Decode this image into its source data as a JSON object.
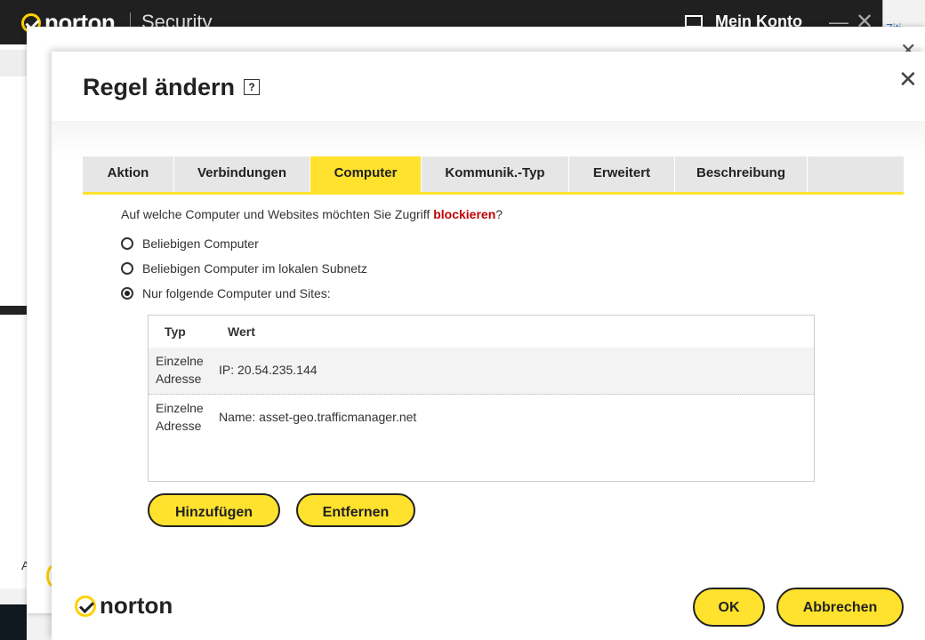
{
  "background_window": {
    "brand": "norton",
    "product": "Security",
    "account_label": "Mein Konto",
    "side_letter": "A",
    "right_edge_text": "Ziti"
  },
  "dialog": {
    "title": "Regel ändern",
    "help_glyph": "?",
    "close_glyph": "✕",
    "tabs": [
      {
        "label": "Aktion",
        "active": false
      },
      {
        "label": "Verbindungen",
        "active": false
      },
      {
        "label": "Computer",
        "active": true
      },
      {
        "label": "Kommunik.-Typ",
        "active": false
      },
      {
        "label": "Erweitert",
        "active": false
      },
      {
        "label": "Beschreibung",
        "active": false
      }
    ],
    "question": {
      "prefix": "Auf welche Computer und Websites möchten Sie Zugriff ",
      "highlight": "blockieren",
      "suffix": "?"
    },
    "options": [
      {
        "label": "Beliebigen Computer",
        "checked": false
      },
      {
        "label": "Beliebigen Computer im lokalen Subnetz",
        "checked": false
      },
      {
        "label": "Nur folgende Computer und Sites:",
        "checked": true
      }
    ],
    "table": {
      "headers": [
        "Typ",
        "Wert"
      ],
      "rows": [
        {
          "typ_line1": "Einzelne",
          "typ_line2": "Adresse",
          "wert": "IP: 20.54.235.144"
        },
        {
          "typ_line1": "Einzelne",
          "typ_line2": "Adresse",
          "wert": "Name: asset-geo.trafficmanager.net"
        }
      ]
    },
    "buttons": {
      "add": "Hinzufügen",
      "remove": "Entfernen",
      "ok": "OK",
      "cancel": "Abbrechen"
    },
    "footer_brand": "norton"
  },
  "colors": {
    "accent_yellow": "#ffe22d",
    "highlight_red": "#c00000"
  }
}
